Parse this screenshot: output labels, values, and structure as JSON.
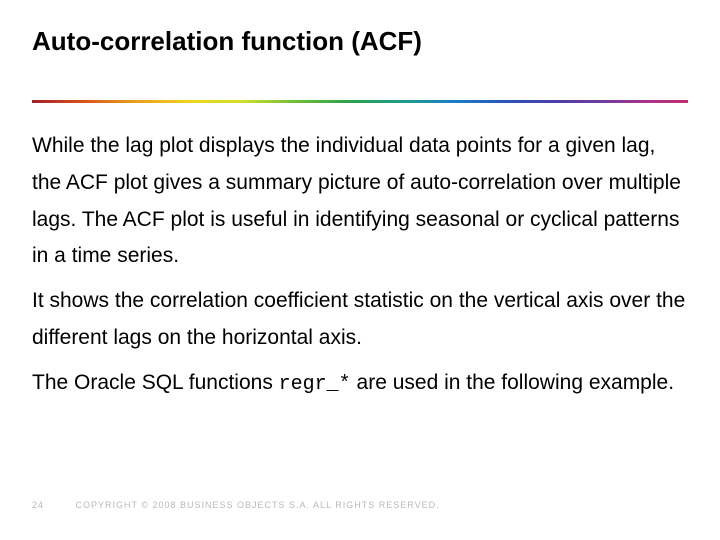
{
  "title": "Auto-correlation function (ACF)",
  "body": {
    "p1": "While the lag plot displays the individual data points for a given lag, the ACF plot gives a summary picture of auto-correlation over multiple lags. The ACF plot is useful in identifying seasonal or cyclical patterns in a time series.",
    "p2": "It shows the correlation coefficient statistic on the vertical axis over the different lags on the horizontal axis.",
    "p3_a": "The Oracle SQL functions ",
    "p3_code": "regr_*",
    "p3_b": " are used in the following example."
  },
  "footer": {
    "page": "24",
    "copyright": "COPYRIGHT © 2008 BUSINESS OBJECTS S.A.  ALL RIGHTS RESERVED."
  }
}
